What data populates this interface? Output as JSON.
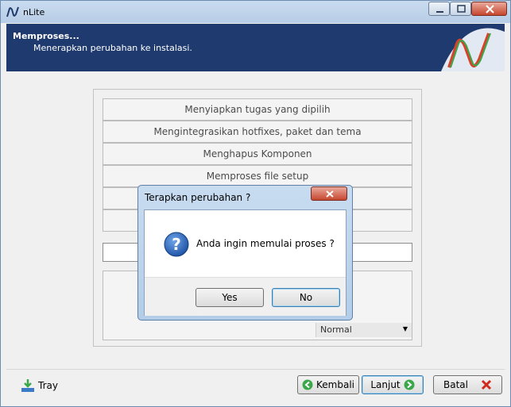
{
  "window": {
    "title": "nLite"
  },
  "header": {
    "title": "Memproses...",
    "subtitle": "Menerapkan perubahan ke instalasi."
  },
  "tasks": [
    "Menyiapkan tugas yang dipilih",
    "Mengintegrasikan hotfixes, paket dan tema",
    "Menghapus Komponen",
    "Memproses file setup",
    "",
    ""
  ],
  "priority": {
    "selected": "Normal"
  },
  "footer": {
    "tray_label": "Tray",
    "back_label": "Kembali",
    "next_label": "Lanjut",
    "cancel_label": "Batal"
  },
  "dialog": {
    "title": "Terapkan perubahan ?",
    "message": "Anda ingin memulai proses ?",
    "yes_label": "Yes",
    "no_label": "No"
  },
  "icons": {
    "app": "nlite-logo-icon",
    "header": "nlite-logo-icon",
    "tray": "download-tray-icon",
    "back": "arrow-left-icon",
    "next": "arrow-right-icon",
    "cancel": "red-x-icon",
    "dialog": "question-icon"
  },
  "colors": {
    "header_bg": "#1f3a6e",
    "accent_green": "#3aa84a",
    "close_red": "#c7462f"
  }
}
